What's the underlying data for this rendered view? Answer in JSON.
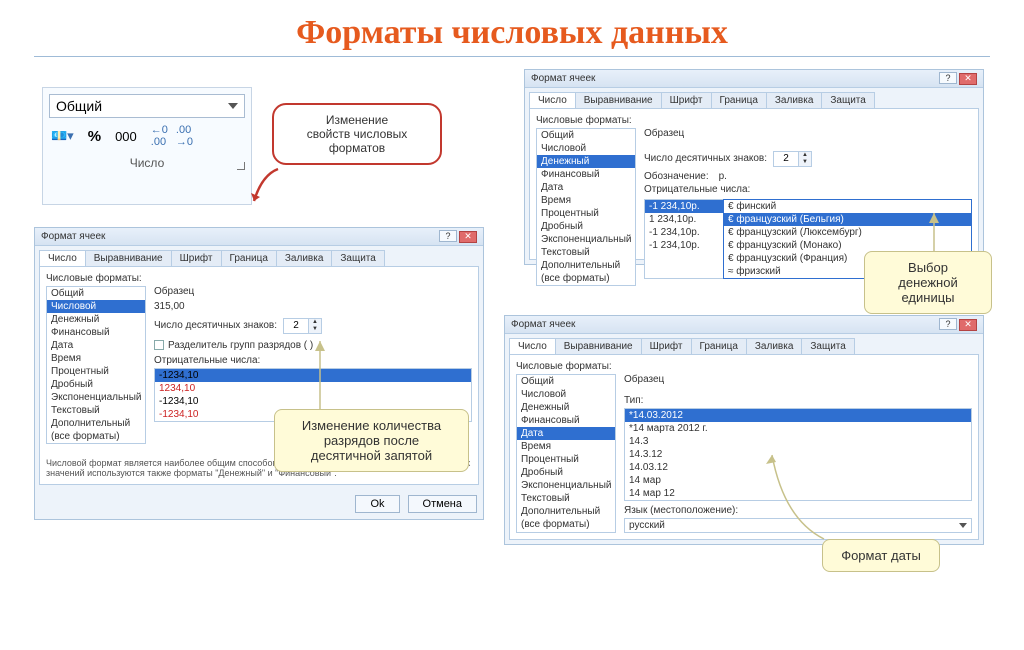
{
  "title": "Форматы числовых данных",
  "ribbon": {
    "combo_value": "Общий",
    "percent_btn": "%",
    "thousands_btn": "000",
    "dec_inc": "←0 .00",
    "dec_dec": ".00 →0",
    "group_label": "Число"
  },
  "callouts": {
    "red": "Изменение\nсвойств числовых\nформатов",
    "decimals": "Изменение количества\nразрядов после\nдесятичной запятой",
    "currency": "Выбор денежной\nединицы",
    "date": "Формат даты"
  },
  "dlg_number": {
    "title": "Формат ячеек",
    "tabs": [
      "Число",
      "Выравнивание",
      "Шрифт",
      "Граница",
      "Заливка",
      "Защита"
    ],
    "list_label": "Числовые форматы:",
    "categories": [
      "Общий",
      "Числовой",
      "Денежный",
      "Финансовый",
      "Дата",
      "Время",
      "Процентный",
      "Дробный",
      "Экспоненциальный",
      "Текстовый",
      "Дополнительный",
      "(все форматы)"
    ],
    "selected_index": 1,
    "sample_label": "Образец",
    "sample_value": "315,00",
    "dec_label": "Число десятичных знаков:",
    "dec_value": "2",
    "thousep": "Разделитель групп разрядов ( )",
    "neg_label": "Отрицательные числа:",
    "neg_values": [
      "-1234,10",
      "1234,10",
      "-1234,10",
      "-1234,10"
    ],
    "neg_colors": [
      "#000",
      "#c22",
      "#000",
      "#c22"
    ],
    "neg_selected": 0,
    "footer": "Числовой формат является наиболее общим способом представления чисел. Для вывода денежных значений используются также форматы \"Денежный\" и \"Финансовый\".",
    "ok": "Ok",
    "cancel": "Отмена"
  },
  "dlg_currency": {
    "title": "Формат ячеек",
    "tabs": [
      "Число",
      "Выравнивание",
      "Шрифт",
      "Граница",
      "Заливка",
      "Защита"
    ],
    "list_label": "Числовые форматы:",
    "categories": [
      "Общий",
      "Числовой",
      "Денежный",
      "Финансовый",
      "Дата",
      "Время",
      "Процентный",
      "Дробный",
      "Экспоненциальный",
      "Текстовый",
      "Дополнительный",
      "(все форматы)"
    ],
    "selected_index": 2,
    "sample_label": "Образец",
    "dec_label": "Число десятичных знаков:",
    "dec_value": "2",
    "sym_label": "Обозначение:",
    "sym_value": "р.",
    "neg_label": "Отрицательные числа:",
    "neg_left": [
      "-1 234,10р.",
      "1 234,10р.",
      "-1 234,10р.",
      "-1 234,10р."
    ],
    "neg_left_sel": 0,
    "dropdown": [
      "€ финский",
      "€ французский (Бельгия)",
      "€ французский (Люксембург)",
      "€ французский (Монако)",
      "€ французский (Франция)",
      "≈ фризский"
    ],
    "dropdown_sel": 1
  },
  "dlg_date": {
    "title": "Формат ячеек",
    "tabs": [
      "Число",
      "Выравнивание",
      "Шрифт",
      "Граница",
      "Заливка",
      "Защита"
    ],
    "list_label": "Числовые форматы:",
    "categories": [
      "Общий",
      "Числовой",
      "Денежный",
      "Финансовый",
      "Дата",
      "Время",
      "Процентный",
      "Дробный",
      "Экспоненциальный",
      "Текстовый",
      "Дополнительный",
      "(все форматы)"
    ],
    "selected_index": 4,
    "sample_label": "Образец",
    "type_label": "Тип:",
    "types": [
      "*14.03.2012",
      "*14 марта 2012 г.",
      "14.3",
      "14.3.12",
      "14.03.12",
      "14 мар",
      "14 мар 12"
    ],
    "type_sel": 0,
    "locale_label": "Язык (местоположение):",
    "locale_value": "русский"
  }
}
